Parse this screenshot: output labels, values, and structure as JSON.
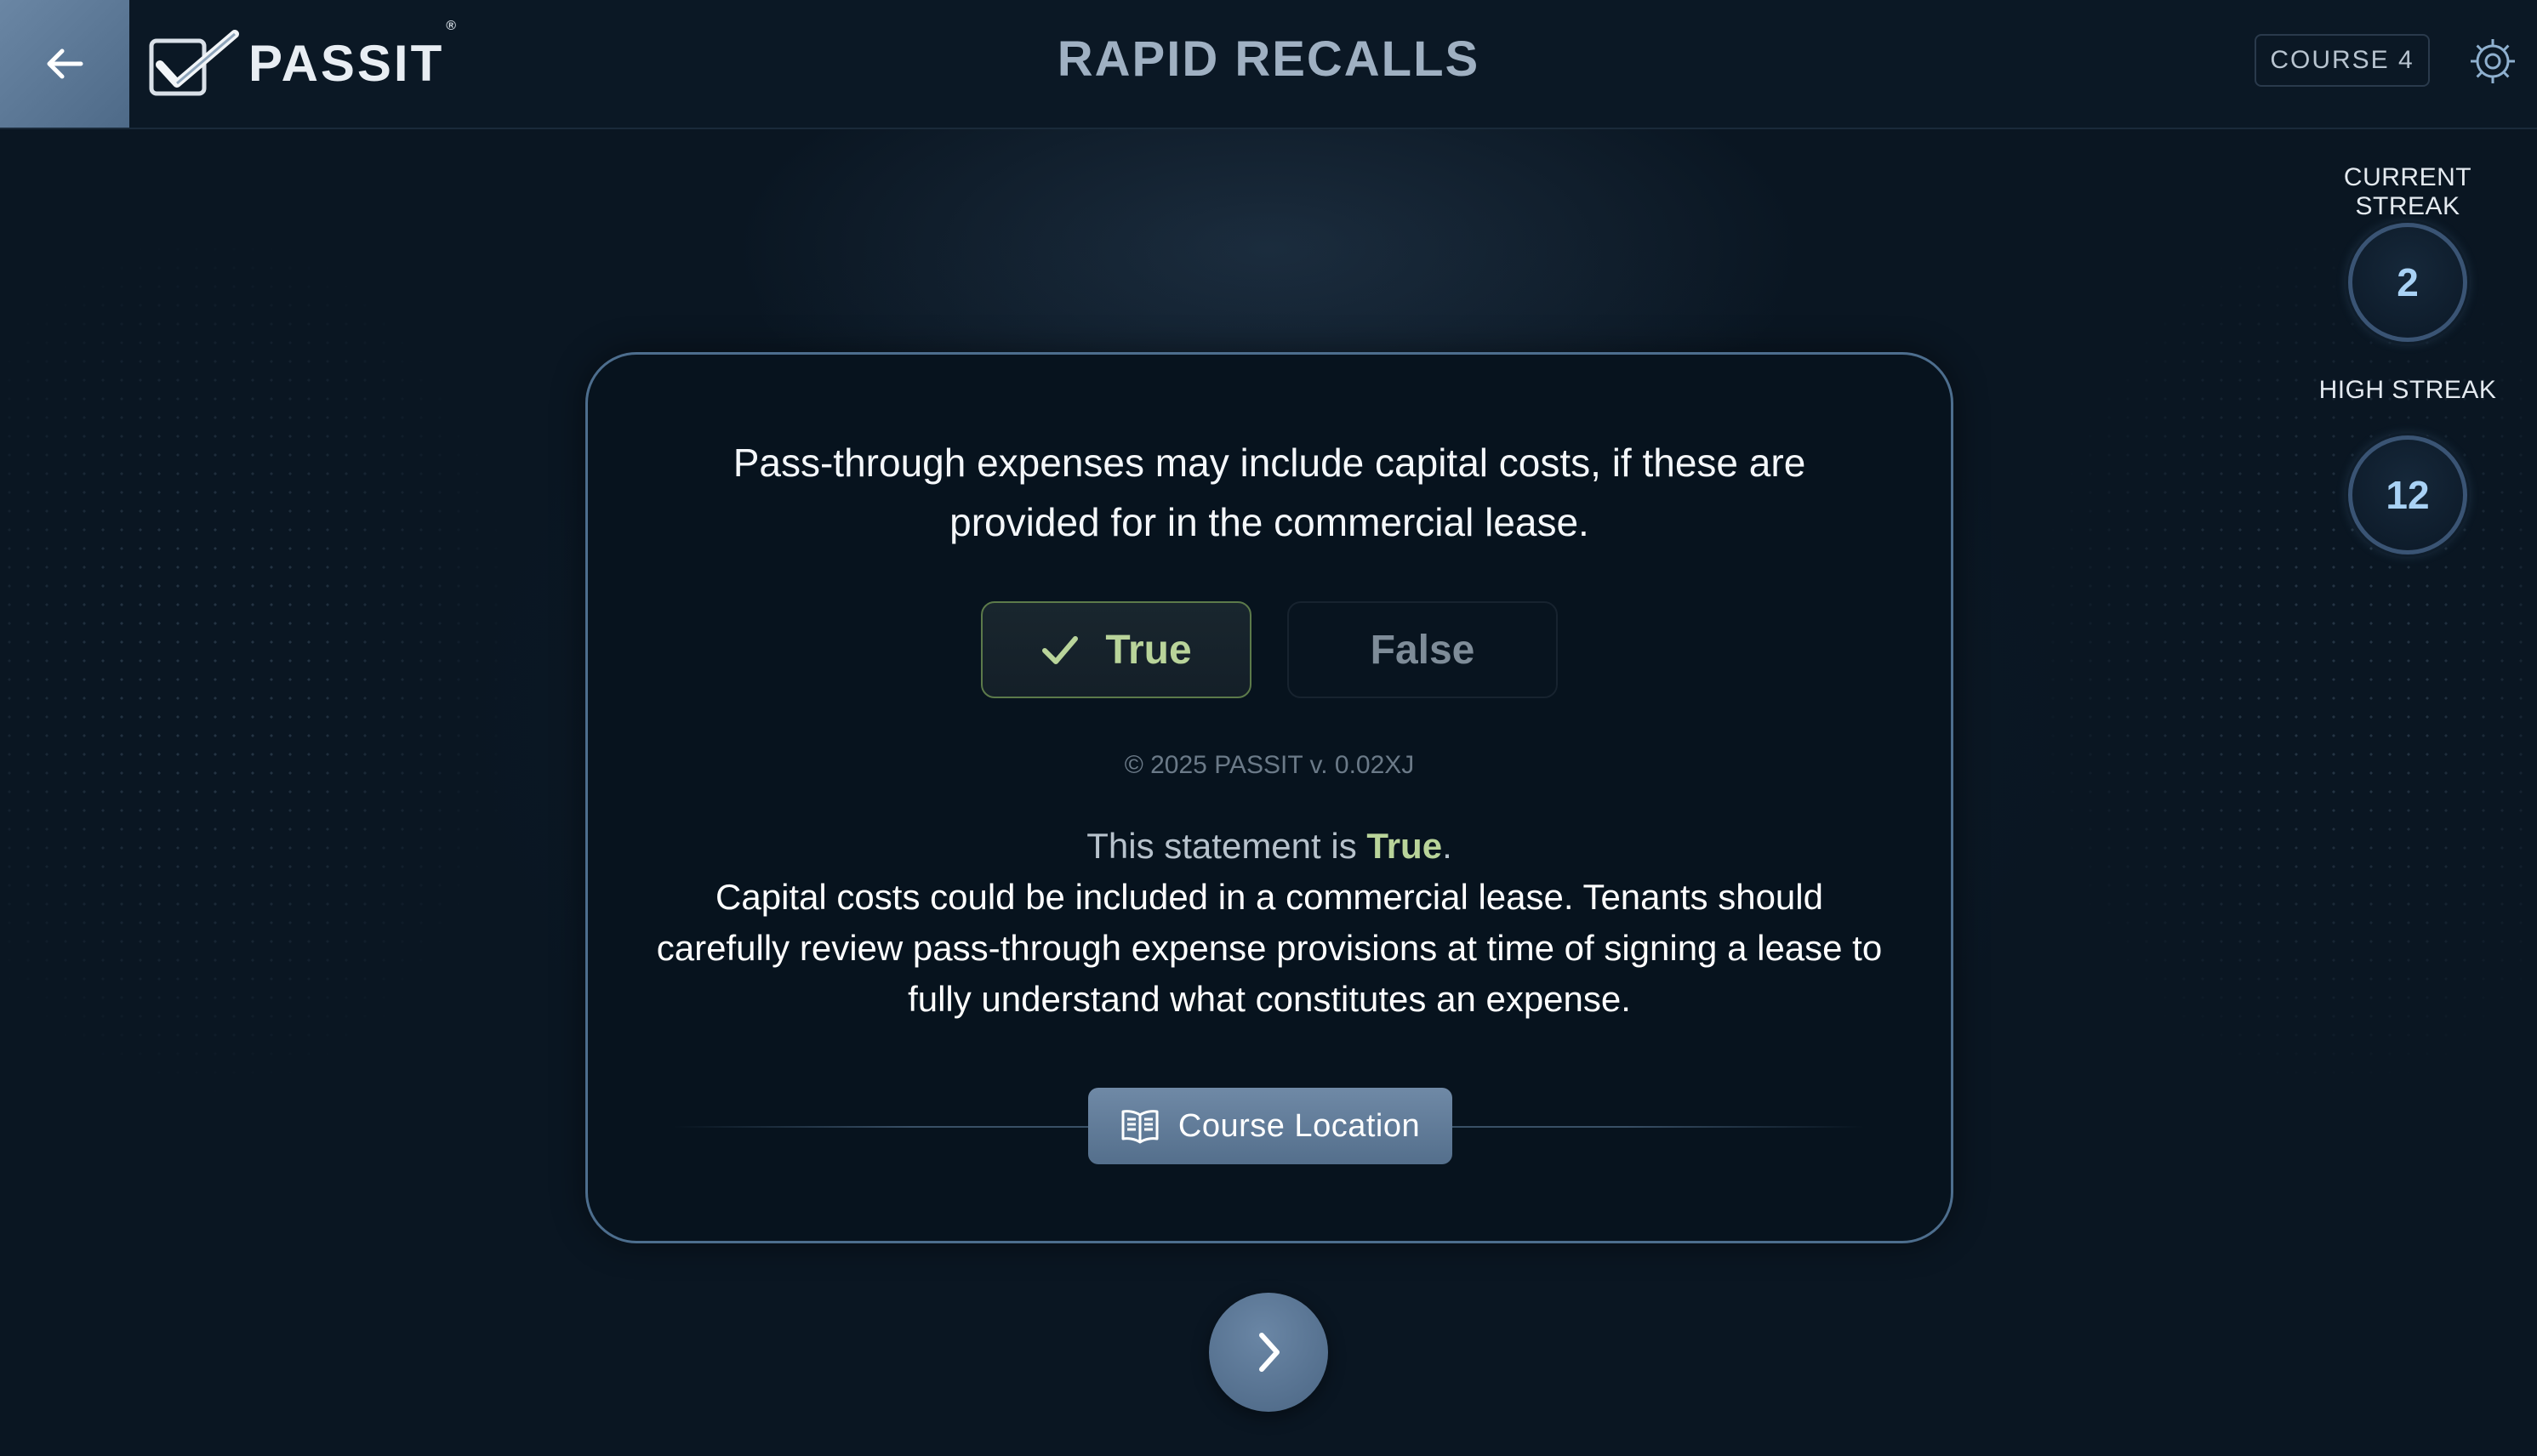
{
  "header": {
    "logo_text": "PASSIT",
    "logo_mark": "®",
    "title": "RAPID RECALLS",
    "course_badge": "COURSE 4"
  },
  "streaks": {
    "current_label": "CURRENT STREAK",
    "current_value": "2",
    "high_label": "HIGH STREAK",
    "high_value": "12"
  },
  "card": {
    "question": "Pass-through expenses may include capital costs, if these are provided for in the commercial lease.",
    "options": [
      {
        "label": "True",
        "selected": true,
        "correct": true
      },
      {
        "label": "False",
        "selected": false
      }
    ],
    "copyright": "© 2025 PASSIT v. 0.02XJ",
    "answer_lead": "This statement is ",
    "answer_value": "True",
    "answer_period": ".",
    "explanation": "Capital costs could be included in a commercial lease. Tenants should carefully review pass-through expense provisions at time of signing a lease to fully understand what constitutes an expense.",
    "course_location_label": "Course Location"
  },
  "icons": {
    "back": "arrow-left-icon",
    "logo": "checkbox-check-icon",
    "settings": "gear-icon",
    "selected": "check-icon",
    "course_location": "open-book-icon",
    "next": "chevron-right-icon"
  },
  "colors": {
    "background": "#0a1622",
    "accent": "#5c7794",
    "correct": "#b9d49a",
    "streak_number": "#a9d2f5"
  }
}
